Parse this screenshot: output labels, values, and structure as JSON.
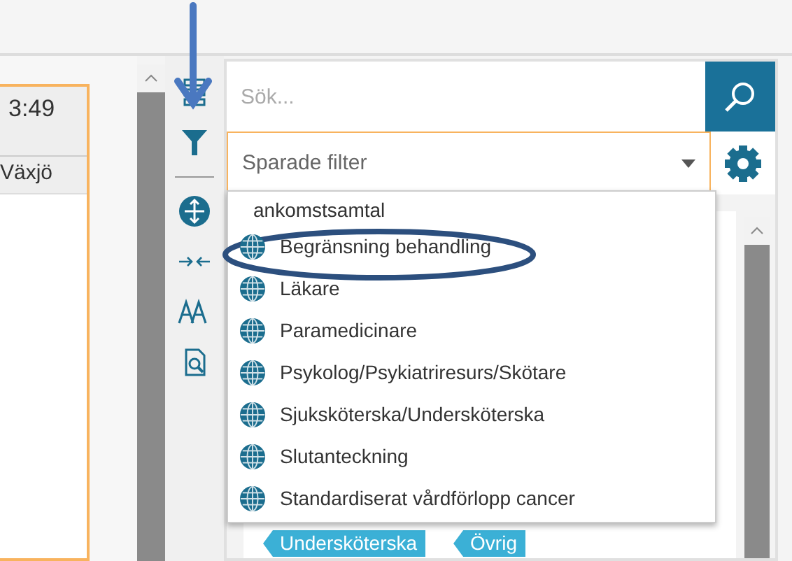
{
  "left_panel": {
    "rows": [
      "3:49",
      "Växjö"
    ]
  },
  "search": {
    "placeholder": "Sök..."
  },
  "saved_filter": {
    "placeholder": "Sparade filter",
    "expanded": true
  },
  "options": [
    {
      "label": "ankomstsamtal",
      "kind": "plain"
    },
    {
      "label": "Begränsning behandling",
      "kind": "globe"
    },
    {
      "label": "Läkare",
      "kind": "globe"
    },
    {
      "label": "Paramedicinare",
      "kind": "globe"
    },
    {
      "label": "Psykolog/Psykiatriresurs/Skötare",
      "kind": "globe"
    },
    {
      "label": "Sjuksköterska/Undersköterska",
      "kind": "globe"
    },
    {
      "label": "Slutanteckning",
      "kind": "globe"
    },
    {
      "label": "Standardiserat vårdförlopp cancer",
      "kind": "globe"
    }
  ],
  "tags": [
    "Undersköterska",
    "Övrig"
  ]
}
